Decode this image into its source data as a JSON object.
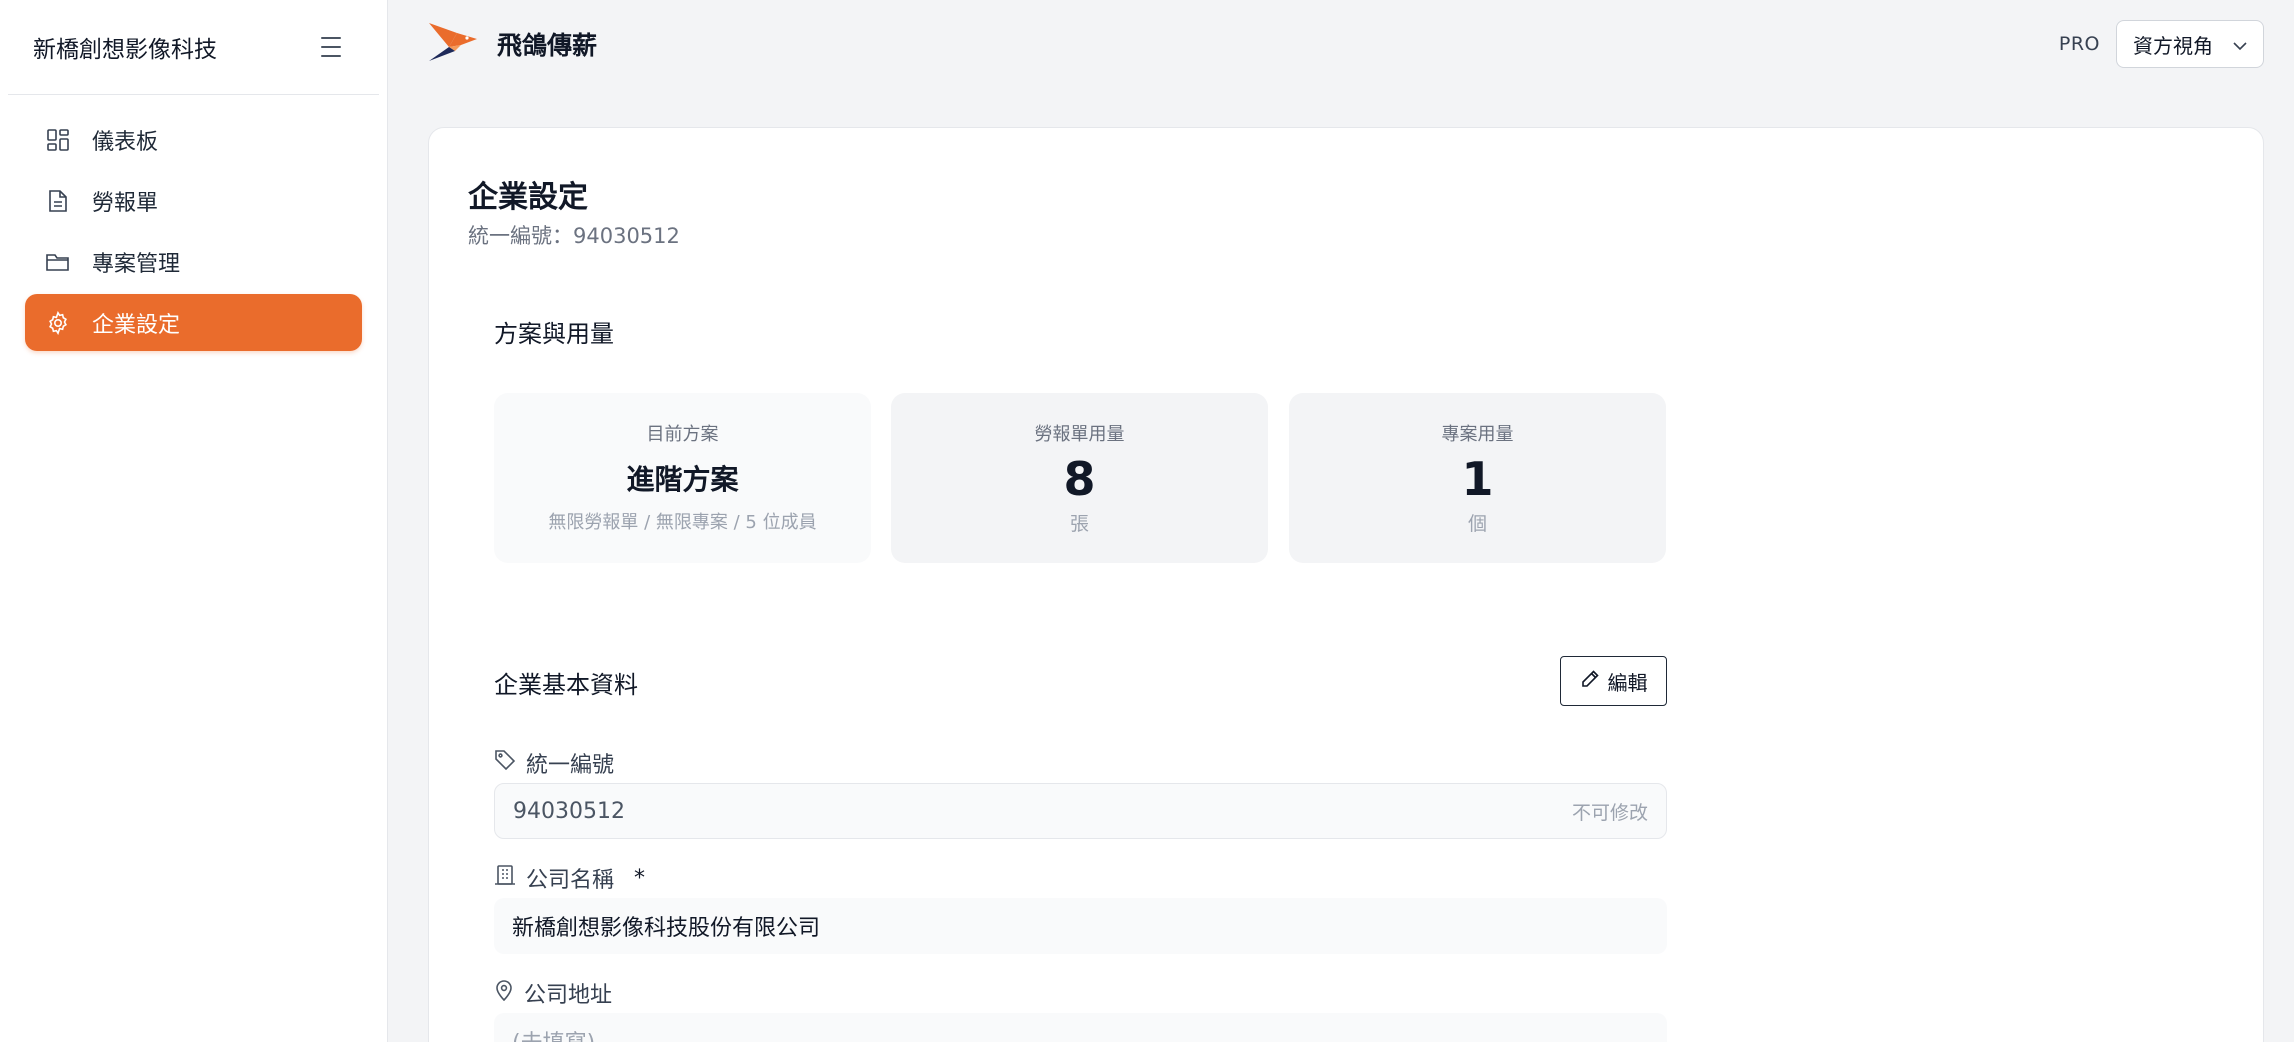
{
  "sidebar": {
    "company": "新橋創想影像科技",
    "items": [
      {
        "label": "儀表板",
        "icon": "dashboard-icon",
        "active": false
      },
      {
        "label": "勞報單",
        "icon": "document-icon",
        "active": false
      },
      {
        "label": "專案管理",
        "icon": "folder-icon",
        "active": false
      },
      {
        "label": "企業設定",
        "icon": "gear-icon",
        "active": true
      }
    ]
  },
  "topbar": {
    "brand": "飛鴿傳薪",
    "badge": "PRO",
    "view": "資方視角"
  },
  "page": {
    "title": "企業設定",
    "subtitle": "統一編號：94030512"
  },
  "plan_section": {
    "title": "方案與用量",
    "current_plan": {
      "label": "目前方案",
      "name": "進階方案",
      "desc": "無限勞報單 / 無限專案 / 5 位成員"
    },
    "report_usage": {
      "label": "勞報單用量",
      "value": "8",
      "unit": "張"
    },
    "project_usage": {
      "label": "專案用量",
      "value": "1",
      "unit": "個"
    }
  },
  "basic_section": {
    "title": "企業基本資料",
    "edit_label": "編輯",
    "tax_id": {
      "label": "統一編號",
      "value": "94030512",
      "note": "不可修改"
    },
    "company_name": {
      "label": "公司名稱",
      "required": "*",
      "value": "新橋創想影像科技股份有限公司"
    },
    "address": {
      "label": "公司地址",
      "placeholder": "(未填寫)"
    }
  },
  "colors": {
    "accent": "#ea6c2c",
    "logo_navy": "#1e2a5a"
  }
}
